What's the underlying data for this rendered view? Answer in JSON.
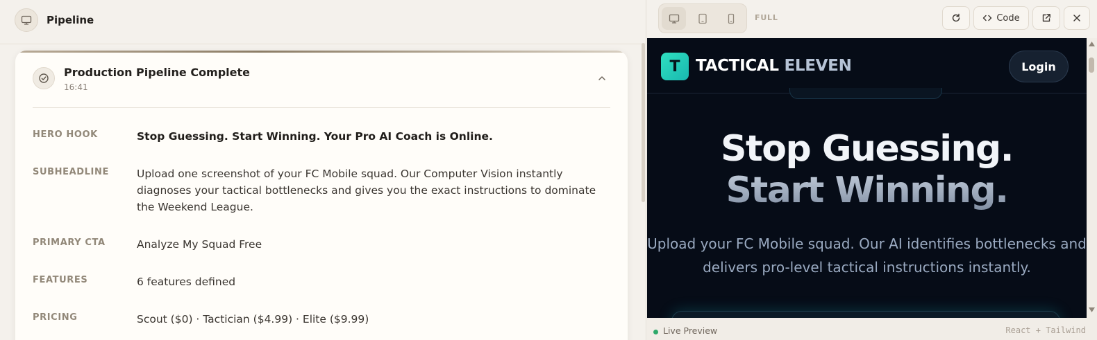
{
  "left": {
    "header": {
      "title": "Pipeline",
      "icon": "monitor-icon"
    },
    "card": {
      "title": "Production Pipeline Complete",
      "time": "16:41",
      "rows": [
        {
          "label": "HERO HOOK",
          "value": "Stop Guessing. Start Winning. Your Pro AI Coach is Online."
        },
        {
          "label": "SUBHEADLINE",
          "value": "Upload one screenshot of your FC Mobile squad. Our Computer Vision instantly diagnoses your tactical bottlenecks and gives you the exact instructions to dominate the Weekend League."
        },
        {
          "label": "PRIMARY CTA",
          "value": "Analyze My Squad Free"
        },
        {
          "label": "FEATURES",
          "value": "6 features defined"
        },
        {
          "label": "PRICING",
          "value": "Scout ($0) · Tactician ($4.99) · Elite ($9.99)"
        }
      ]
    }
  },
  "right": {
    "toolbar": {
      "mode_label": "FULL",
      "code_label": "Code",
      "device_icons": [
        "desktop-icon",
        "tablet-icon",
        "mobile-icon"
      ]
    },
    "preview": {
      "logo_letter": "T",
      "brand_part1": "TACTICAL",
      "brand_part2": "ELEVEN",
      "login_label": "Login",
      "hero_line1": "Stop Guessing.",
      "hero_line2": "Start Winning.",
      "subtext": "Upload your FC Mobile squad. Our AI identifies bottlenecks and delivers pro-level tactical instructions instantly."
    },
    "status": {
      "live_label": "Live Preview",
      "stack_label": "React + Tailwind"
    }
  },
  "colors": {
    "accent_teal": "#2fe0c0",
    "live_dot": "#2ea96a",
    "preview_bg": "#060c17"
  }
}
